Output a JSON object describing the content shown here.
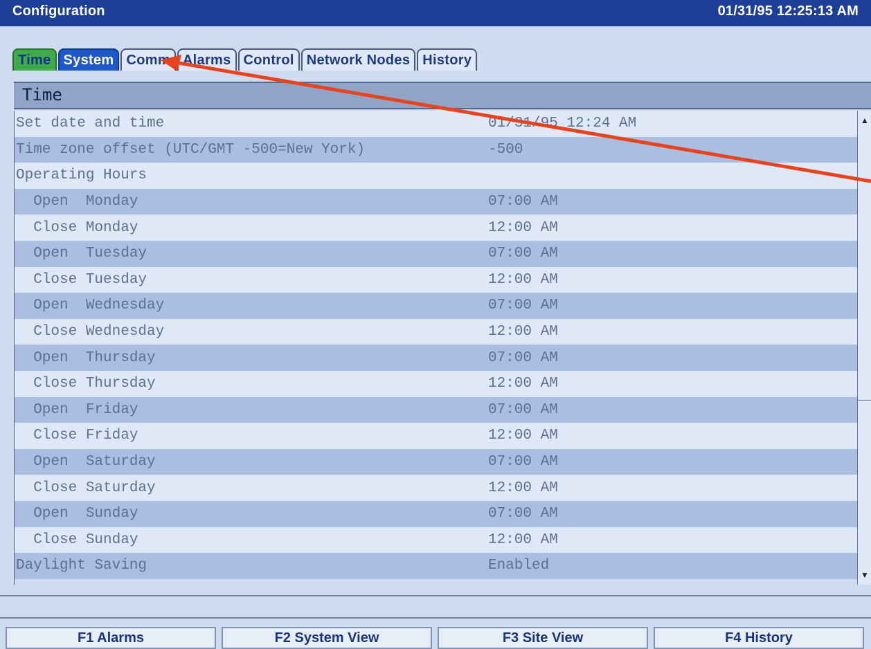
{
  "window": {
    "title": "Configuration",
    "datetime": "01/31/95 12:25:13 AM"
  },
  "tabs": [
    {
      "label": "Time",
      "state": "current"
    },
    {
      "label": "System",
      "state": "selected"
    },
    {
      "label": "Comm",
      "state": "normal"
    },
    {
      "label": "Alarms",
      "state": "normal"
    },
    {
      "label": "Control",
      "state": "normal"
    },
    {
      "label": "Network Nodes",
      "state": "normal"
    },
    {
      "label": "History",
      "state": "normal"
    }
  ],
  "section": {
    "title": "Time"
  },
  "rows": [
    {
      "label": "Set date and time",
      "value": "01/31/95 12:24 AM"
    },
    {
      "label": "Time zone offset (UTC/GMT -500=New York)",
      "value": "-500"
    },
    {
      "label": "Operating Hours",
      "value": ""
    },
    {
      "label": "  Open  Monday",
      "value": "07:00 AM"
    },
    {
      "label": "  Close Monday",
      "value": "12:00 AM"
    },
    {
      "label": "  Open  Tuesday",
      "value": "07:00 AM"
    },
    {
      "label": "  Close Tuesday",
      "value": "12:00 AM"
    },
    {
      "label": "  Open  Wednesday",
      "value": "07:00 AM"
    },
    {
      "label": "  Close Wednesday",
      "value": "12:00 AM"
    },
    {
      "label": "  Open  Thursday",
      "value": "07:00 AM"
    },
    {
      "label": "  Close Thursday",
      "value": "12:00 AM"
    },
    {
      "label": "  Open  Friday",
      "value": "07:00 AM"
    },
    {
      "label": "  Close Friday",
      "value": "12:00 AM"
    },
    {
      "label": "  Open  Saturday",
      "value": "07:00 AM"
    },
    {
      "label": "  Close Saturday",
      "value": "12:00 AM"
    },
    {
      "label": "  Open  Sunday",
      "value": "07:00 AM"
    },
    {
      "label": "  Close Sunday",
      "value": "12:00 AM"
    },
    {
      "label": "Daylight Saving",
      "value": "Enabled"
    }
  ],
  "scrollbar": {
    "up_icon": "arrow-up-icon",
    "down_icon": "arrow-down-icon"
  },
  "function_keys": [
    {
      "label": "F1 Alarms"
    },
    {
      "label": "F2 System View"
    },
    {
      "label": "F3 Site View"
    },
    {
      "label": "F4 History"
    }
  ],
  "colors": {
    "titlebar": "#1e3f97",
    "tab_current": "#3faa4a",
    "tab_selected": "#1f58c9",
    "annotation_arrow": "#e8431c"
  }
}
